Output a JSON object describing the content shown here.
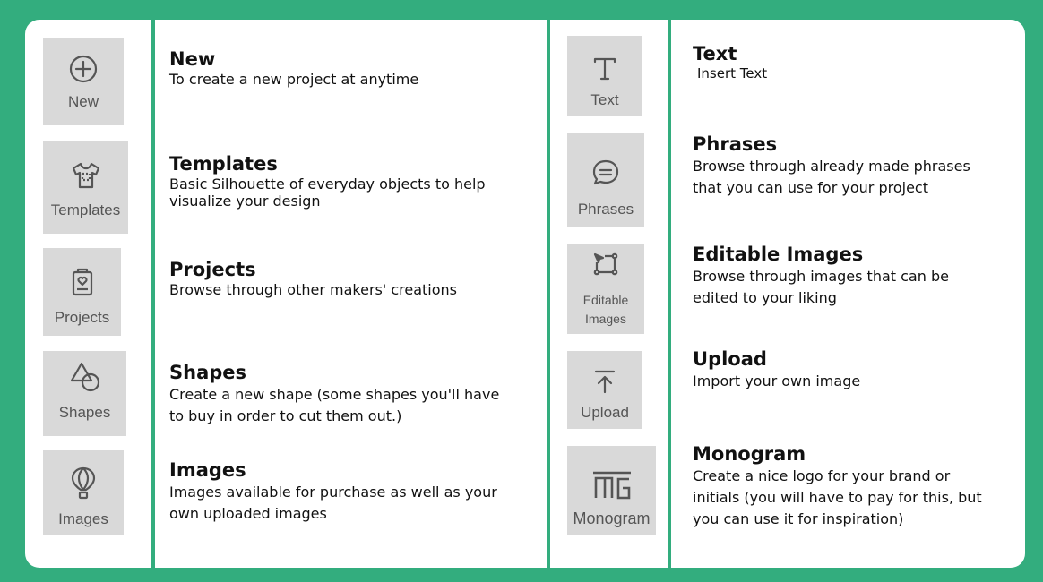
{
  "left_tools": [
    {
      "label": "New",
      "title": "New",
      "desc": "To create a new project at anytime",
      "icon": "plus-circle-icon"
    },
    {
      "label": "Templates",
      "title": "Templates",
      "desc": "Basic Silhouette of everyday objects to help visualize your design",
      "icon": "shirt-icon"
    },
    {
      "label": "Projects",
      "title": "Projects",
      "desc": "Browse through other makers' creations",
      "icon": "project-heart-icon"
    },
    {
      "label": "Shapes",
      "title": "Shapes",
      "desc": "Create a new shape (some shapes you'll have to buy in order to cut them out.)",
      "icon": "shapes-icon"
    },
    {
      "label": "Images",
      "title": "Images",
      "desc": "Images available for purchase as well as your own uploaded images",
      "icon": "balloon-icon"
    }
  ],
  "right_tools": [
    {
      "label": "Text",
      "title": "Text",
      "desc": "Insert Text",
      "icon": "text-t-icon"
    },
    {
      "label": "Phrases",
      "title": "Phrases",
      "desc": "Browse through already made phrases that you can use for your project",
      "icon": "speech-bubble-icon"
    },
    {
      "label_line1": "Editable",
      "label_line2": "Images",
      "title": "Editable Images",
      "desc": "Browse through images that can be edited to your liking",
      "icon": "editable-image-icon"
    },
    {
      "label": "Upload",
      "title": "Upload",
      "desc": "Import your own image",
      "icon": "upload-icon"
    },
    {
      "label": "Monogram",
      "title": "Monogram",
      "desc": "Create a nice logo for your brand or initials (you will have to pay for this, but you can use it for inspiration)",
      "icon": "monogram-icon"
    }
  ],
  "colors": {
    "background": "#33ad7e",
    "card": "#ffffff",
    "tile": "#d9d9d9",
    "icon": "#555555"
  }
}
